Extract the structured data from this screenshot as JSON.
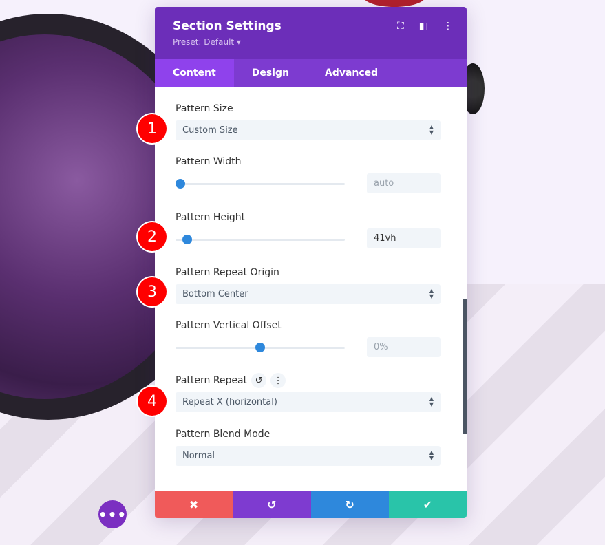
{
  "header": {
    "title": "Section Settings",
    "preset": "Preset: Default ▾"
  },
  "tabs": [
    {
      "label": "Content"
    },
    {
      "label": "Design"
    },
    {
      "label": "Advanced"
    }
  ],
  "fields": {
    "pattern_size": {
      "label": "Pattern Size",
      "value": "Custom Size"
    },
    "pattern_width": {
      "label": "Pattern Width",
      "value": "auto",
      "slider_percent": 3
    },
    "pattern_height": {
      "label": "Pattern Height",
      "value": "41vh",
      "slider_percent": 7
    },
    "repeat_origin": {
      "label": "Pattern Repeat Origin",
      "value": "Bottom Center"
    },
    "vertical_offset": {
      "label": "Pattern Vertical Offset",
      "value": "0%",
      "slider_percent": 50
    },
    "pattern_repeat": {
      "label": "Pattern Repeat",
      "value": "Repeat X (horizontal)"
    },
    "blend_mode": {
      "label": "Pattern Blend Mode",
      "value": "Normal"
    }
  },
  "badges": [
    "1",
    "2",
    "3",
    "4"
  ],
  "footer": {
    "cancel": "✖",
    "undo": "↺",
    "redo": "↻",
    "save": "✔"
  },
  "colors": {
    "header": "#6c2eb9",
    "tabs": "#7d3bd0",
    "active_tab": "#8f42ec",
    "cancel": "#f05a5a",
    "undo": "#7e3bd0",
    "redo": "#2e88dc",
    "save": "#29c4a9",
    "badge": "#ff0000"
  },
  "floating_button": "•••"
}
